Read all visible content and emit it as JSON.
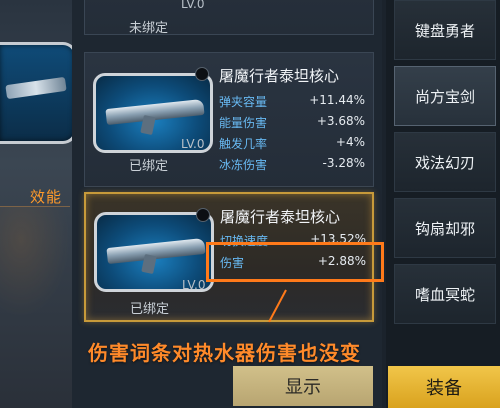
{
  "left_panel": {
    "label": "效能"
  },
  "cards": [
    {
      "lv": "LV.0",
      "status": "未绑定"
    },
    {
      "name": "屠魔行者泰坦核心",
      "stats": [
        {
          "key": "弹夹容量",
          "value": "+11.44%"
        },
        {
          "key": "能量伤害",
          "value": "+3.68%"
        },
        {
          "key": "触发几率",
          "value": "+4%"
        },
        {
          "key": "冰冻伤害",
          "value": "-3.28%"
        }
      ],
      "lv": "LV.0",
      "status": "已绑定"
    },
    {
      "name": "屠魔行者泰坦核心",
      "stats": [
        {
          "key": "切换速度",
          "value": "+13.52%"
        },
        {
          "key": "伤害",
          "value": "+2.88%"
        }
      ],
      "lv": "LV.0",
      "status": "已绑定"
    }
  ],
  "annotation": "伤害词条对热水器伤害也没变",
  "tabs": [
    "键盘勇者",
    "尚方宝剑",
    "戏法幻刃",
    "钩扇却邪",
    "嗜血冥蛇"
  ],
  "buttons": {
    "display": "显示",
    "equip": "装备"
  },
  "colors": {
    "highlight": "#ff7a1a",
    "stat_key": "#68b9f2",
    "equip": "#f1c64a"
  }
}
